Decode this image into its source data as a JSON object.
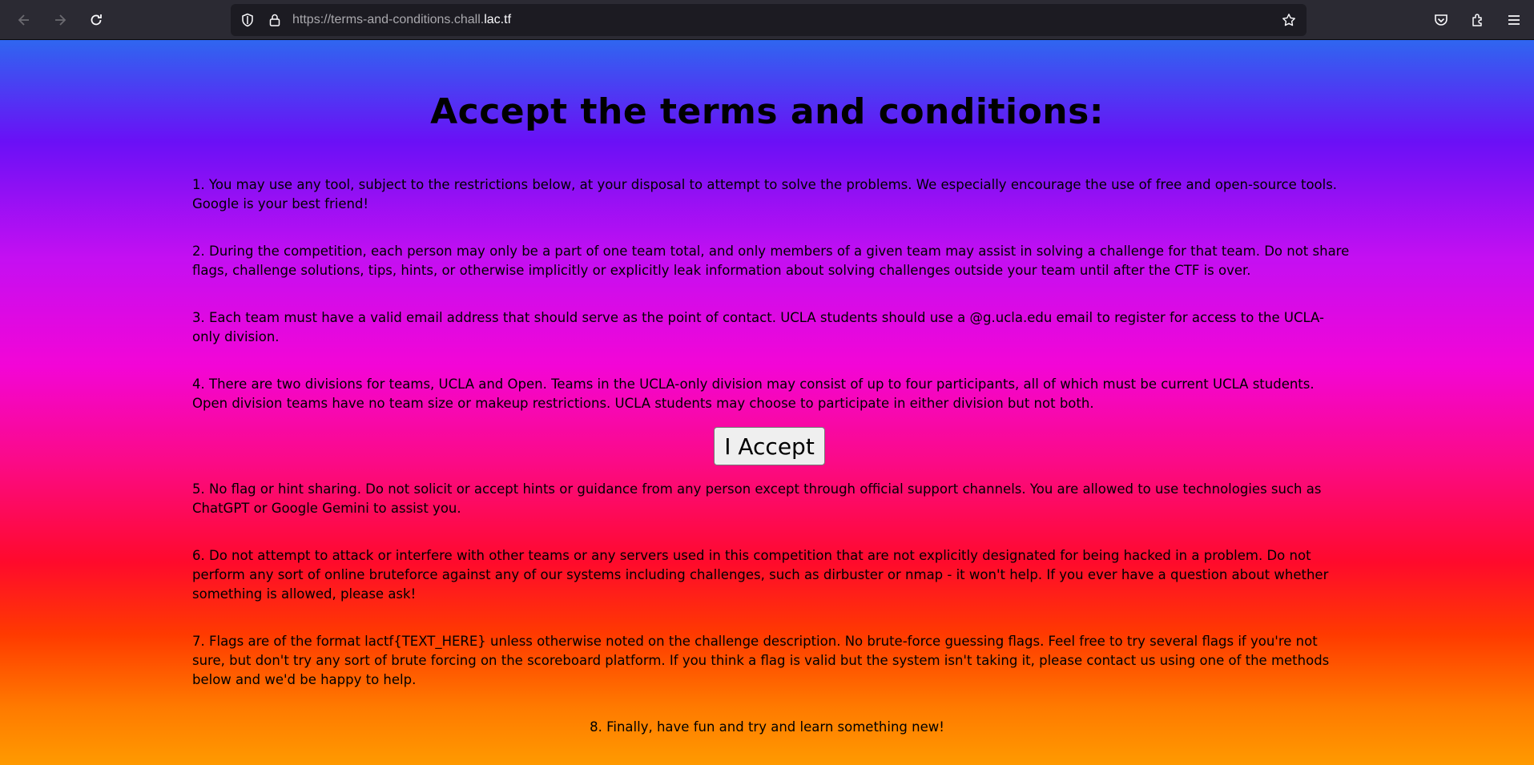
{
  "browser": {
    "url_prefix": "https://terms-and-conditions.chall.",
    "url_host": "lac.tf",
    "icons": [
      "back-arrow-icon",
      "forward-arrow-icon",
      "reload-icon",
      "shield-icon",
      "lock-icon",
      "star-icon",
      "pocket-icon",
      "extensions-icon",
      "menu-icon"
    ]
  },
  "page": {
    "heading": "Accept the terms and conditions:",
    "terms": [
      "1. You may use any tool, subject to the restrictions below, at your disposal to attempt to solve the problems. We especially encourage the use of free and open-source tools. Google is your best friend!",
      "2. During the competition, each person may only be a part of one team total, and only members of a given team may assist in solving a challenge for that team. Do not share flags, challenge solutions, tips, hints, or otherwise implicitly or explicitly leak information about solving challenges outside your team until after the CTF is over.",
      "3. Each team must have a valid email address that should serve as the point of contact. UCLA students should use a @g.ucla.edu email to register for access to the UCLA-only division.",
      "4. There are two divisions for teams, UCLA and Open. Teams in the UCLA-only division may consist of up to four participants, all of which must be current UCLA students. Open division teams have no team size or makeup restrictions. UCLA students may choose to participate in either division but not both.",
      "5. No flag or hint sharing. Do not solicit or accept hints or guidance from any person except through official support channels. You are allowed to use technologies such as ChatGPT or Google Gemini to assist you.",
      "6. Do not attempt to attack or interfere with other teams or any servers used in this competition that are not explicitly designated for being hacked in a problem. Do not perform any sort of online bruteforce against any of our systems including challenges, such as dirbuster or nmap - it won't help. If you ever have a question about whether something is allowed, please ask!",
      "7. Flags are of the format lactf{TEXT_HERE} unless otherwise noted on the challenge description. No brute-force guessing flags. Feel free to try several flags if you're not sure, but don't try any sort of brute forcing on the scoreboard platform. If you think a flag is valid but the system isn't taking it, please contact us using one of the methods below and we'd be happy to help.",
      "8. Finally, have fun and try and learn something new!"
    ],
    "accept_button": "I Accept"
  }
}
